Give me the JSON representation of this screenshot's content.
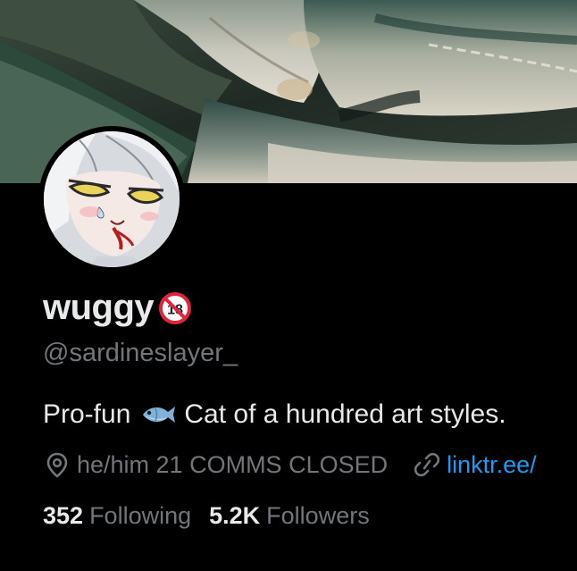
{
  "profile": {
    "display_name": "wuggy",
    "age_badge": "18",
    "handle": "@sardineslayer_",
    "bio_before": "Pro-fun",
    "bio_after": "Cat of a hundred art styles.",
    "location": "he/him 21 COMMS CLOSED",
    "website": "linktr.ee/"
  },
  "stats": {
    "following_count": "352",
    "following_label": "Following",
    "followers_count": "5.2K",
    "followers_label": "Followers"
  },
  "icons": {
    "location": "location-pin-icon",
    "link": "link-icon",
    "bio_emoji": "fish-icon",
    "badge": "no-under-18-icon"
  },
  "colors": {
    "background": "#000000",
    "text_primary": "#e7e9ea",
    "text_secondary": "#71767b",
    "link": "#1d9bf0",
    "badge_red": "#e0243a"
  }
}
